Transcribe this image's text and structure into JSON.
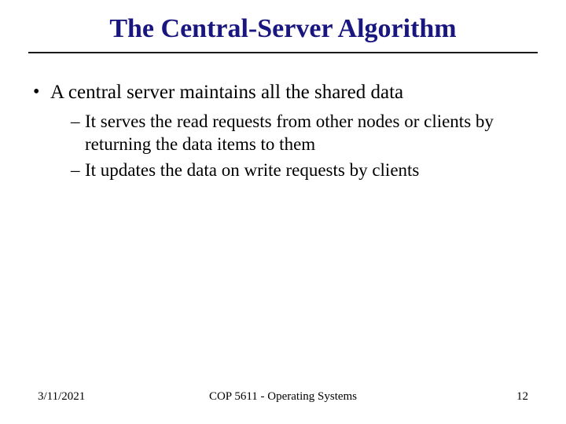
{
  "title": "The Central-Server Algorithm",
  "bullets": {
    "main": "A central server maintains all the shared data",
    "sub1": "It serves the read requests from other nodes or clients by returning the data items to them",
    "sub2": "It updates the data on write requests by clients"
  },
  "footer": {
    "date": "3/11/2021",
    "course": "COP 5611 - Operating Systems",
    "page": "12"
  }
}
